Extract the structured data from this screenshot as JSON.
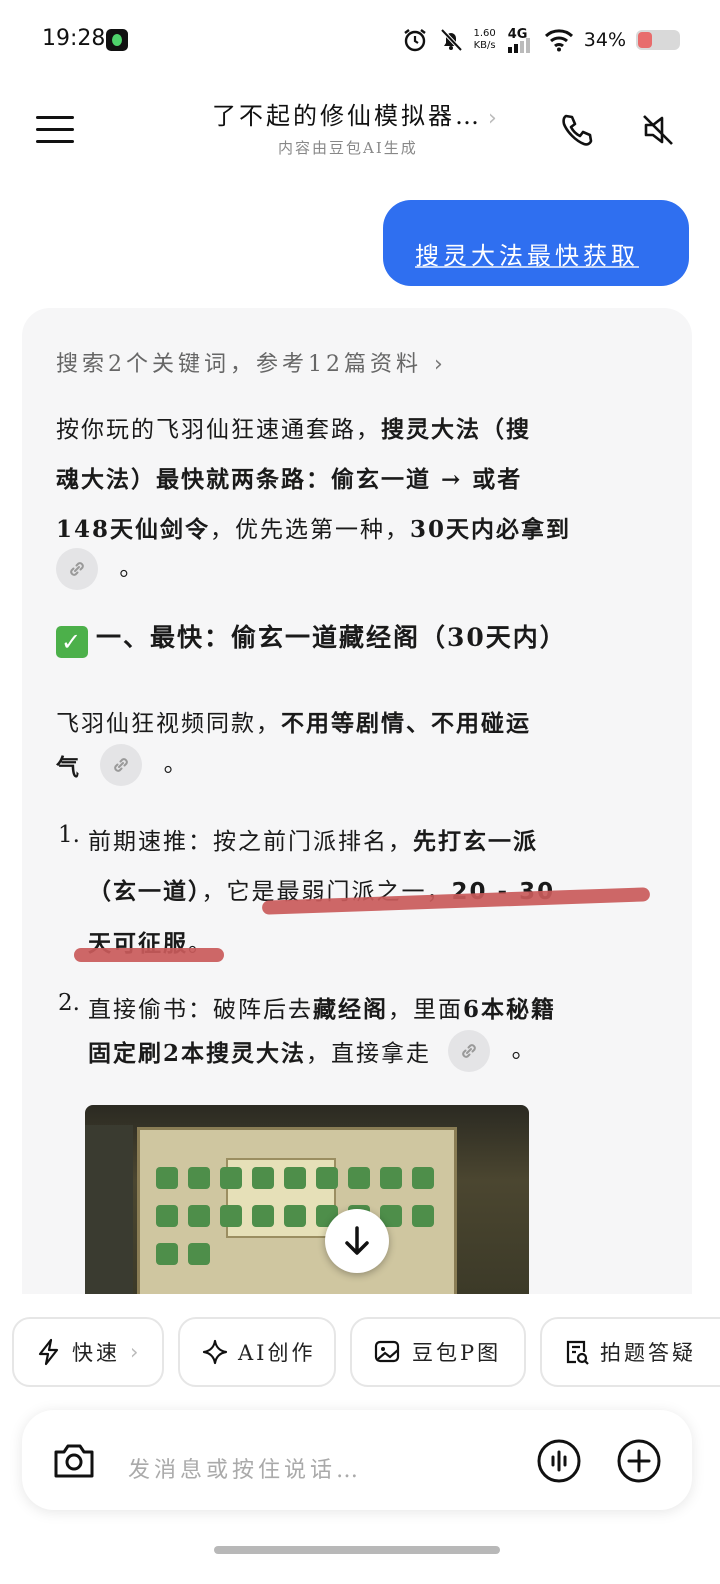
{
  "status_bar": {
    "time": "19:28",
    "speed_value": "1.60",
    "speed_unit": "KB/s",
    "network": "4G",
    "battery": "34%",
    "battery_level": 0.34
  },
  "header": {
    "title": "了不起的修仙模拟器…",
    "subtitle": "内容由豆包AI生成"
  },
  "user_message": "搜灵大法最快获取",
  "answer": {
    "search_summary": "搜索2个关键词，参考12篇资料",
    "intro": {
      "l1_a": "按你玩的飞羽仙狂速通套路，",
      "l1_b": "搜灵大法（搜",
      "l2": "魂大法）最快就两条路：偷玄一道 → 或者",
      "l3_a": "148天仙剑令",
      "l3_b": "，优先选第一种，",
      "l3_c": "30天内必拿到",
      "l4_end": "。"
    },
    "section_title": "一、最快：偷玄一道藏经阁（30天内）",
    "section_intro": {
      "l1_a": "飞羽仙狂视频同款，",
      "l1_b": "不用等剧情、不用碰运",
      "l2_a": "气",
      "l2_end": "。"
    },
    "steps": [
      {
        "num": "1.",
        "l1_a": "前期速推：按之前门派排名，",
        "l1_b": "先打玄一派",
        "l2_a": "（玄一道）",
        "l2_b": "，它是最弱门派之一，",
        "l2_c": "20 - 30",
        "l3_a": "天可征服",
        "l3_b": "。"
      },
      {
        "num": "2.",
        "l1_a": "直接偷书：破阵后去",
        "l1_b": "藏经阁",
        "l1_c": "，里面",
        "l1_d": "6本秘籍",
        "l2_a": "固定刷2本搜灵大法",
        "l2_b": "，直接拿走",
        "l2_end": "。"
      }
    ]
  },
  "chips": [
    {
      "label": "快速",
      "icon": "lightning-icon"
    },
    {
      "label": "AI创作",
      "icon": "sparkle-icon"
    },
    {
      "label": "豆包P图",
      "icon": "image-edit-icon"
    },
    {
      "label": "拍题答疑",
      "icon": "scan-question-icon"
    }
  ],
  "input": {
    "placeholder": "发消息或按住说话…"
  },
  "colors": {
    "user_bubble": "#2f6ff0",
    "annotation_red": "#c95a5a",
    "card_bg": "#f6f6f7"
  }
}
